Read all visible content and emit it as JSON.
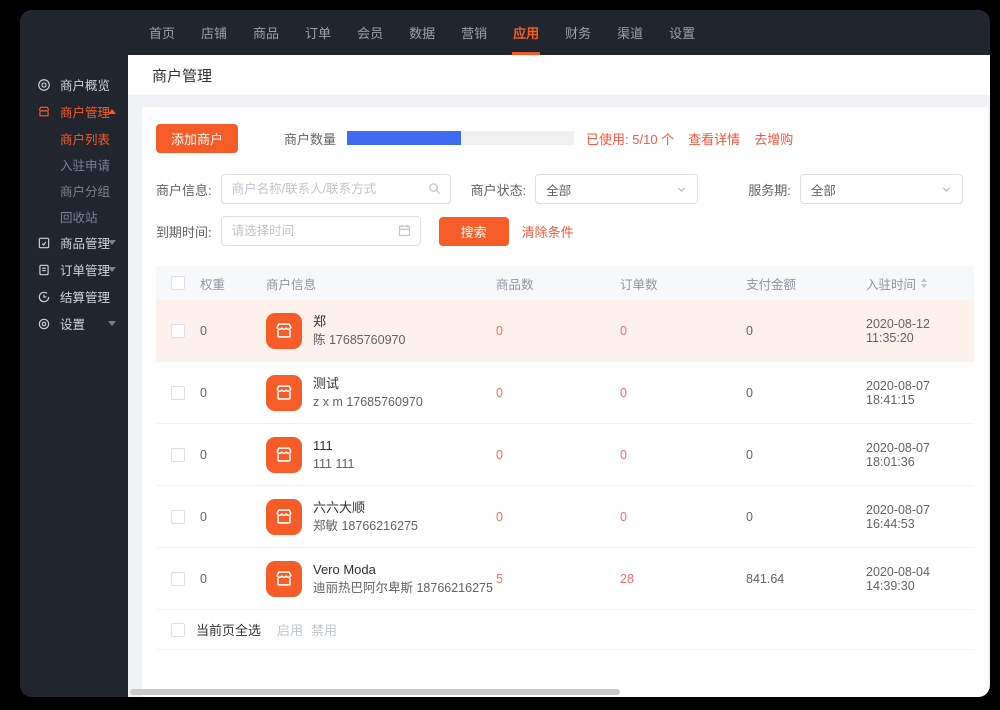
{
  "colors": {
    "accent_orange": "#f55c27",
    "progress_blue": "#3e6bf2",
    "red_text": "#f5573b",
    "count_red": "#f56c6c",
    "dark_bg": "#21252e",
    "row_highlight": "#fdf1ec"
  },
  "nav": {
    "items": [
      {
        "label": "首页"
      },
      {
        "label": "店铺"
      },
      {
        "label": "商品"
      },
      {
        "label": "订单"
      },
      {
        "label": "会员"
      },
      {
        "label": "数据"
      },
      {
        "label": "营销"
      },
      {
        "label": "应用"
      },
      {
        "label": "财务"
      },
      {
        "label": "渠道"
      },
      {
        "label": "设置"
      }
    ],
    "active": "应用"
  },
  "sidebar": {
    "overview": "商户概览",
    "merchant_mgmt": "商户管理",
    "merchant_list": "商户列表",
    "apply": "入驻申请",
    "groups": "商户分组",
    "recycle": "回收站",
    "product_mgmt": "商品管理",
    "order_mgmt": "订单管理",
    "settle_mgmt": "结算管理",
    "settings": "设置"
  },
  "page": {
    "title": "商户管理"
  },
  "toolbar": {
    "add_button": "添加商户",
    "quota_label": "商户数量",
    "quota_used": 5,
    "quota_total": 10,
    "used_text": "已使用: 5/10 个",
    "view_detail": "查看详情",
    "buy_more": "去增购"
  },
  "filters": {
    "merchant_info_label": "商户信息:",
    "merchant_info_placeholder": "商户名称/联系人/联系方式",
    "status_label": "商户状态:",
    "status_value": "全部",
    "service_label": "服务期:",
    "service_value": "全部",
    "expire_label": "到期时间:",
    "expire_placeholder": "请选择时间",
    "search_button": "搜索",
    "clear_button": "清除条件"
  },
  "table": {
    "headers": [
      "权重",
      "商户信息",
      "商品数",
      "订单数",
      "支付金额",
      "入驻时间"
    ],
    "rows": [
      {
        "weight": "0",
        "name": "郑",
        "contact": "陈 17685760970",
        "products": "0",
        "orders": "0",
        "payment": "0",
        "joined": "2020-08-12 11:35:20"
      },
      {
        "weight": "0",
        "name": "测试",
        "contact": "z x m 17685760970",
        "products": "0",
        "orders": "0",
        "payment": "0",
        "joined": "2020-08-07 18:41:15"
      },
      {
        "weight": "0",
        "name": "111",
        "contact": "111 111",
        "products": "0",
        "orders": "0",
        "payment": "0",
        "joined": "2020-08-07 18:01:36"
      },
      {
        "weight": "0",
        "name": "六六大顺",
        "contact": "郑敏 18766216275",
        "products": "0",
        "orders": "0",
        "payment": "0",
        "joined": "2020-08-07 16:44:53"
      },
      {
        "weight": "0",
        "name": "Vero Moda",
        "contact": "迪丽热巴阿尔卑斯 18766216275",
        "products": "5",
        "orders": "28",
        "payment": "841.64",
        "joined": "2020-08-04 14:39:30"
      }
    ],
    "footer": {
      "select_all": "当前页全选",
      "enable": "启用",
      "disable": "禁用"
    }
  }
}
